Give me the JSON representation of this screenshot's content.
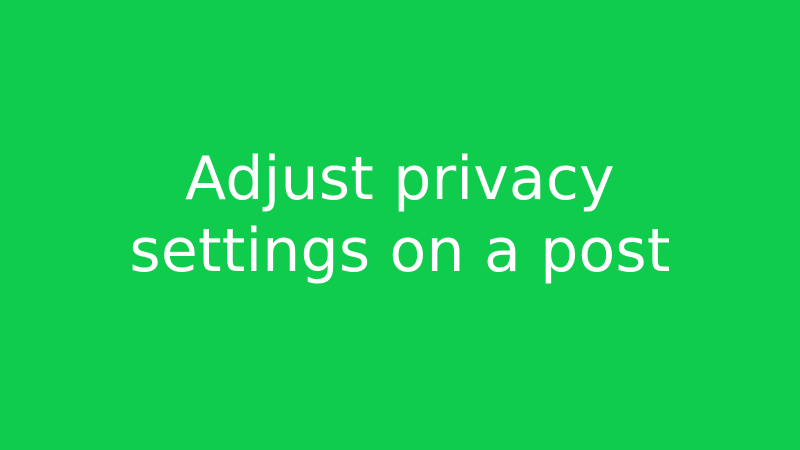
{
  "slide": {
    "background_color": "#10cc4c",
    "text_color": "#ffffff",
    "title_line_1": "Adjust privacy",
    "title_line_2": "settings on a post"
  }
}
